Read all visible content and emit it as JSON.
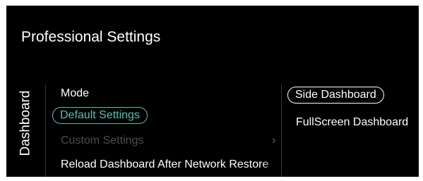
{
  "header": {
    "title": "Professional Settings"
  },
  "sidebar": {
    "tab_label": "Dashboard"
  },
  "menu": {
    "items": [
      {
        "label": "Mode",
        "state": "normal"
      },
      {
        "label": "Default Settings",
        "state": "selected"
      },
      {
        "label": "Custom Settings",
        "state": "disabled"
      },
      {
        "label": "Reload Dashboard After Network Restore",
        "state": "normal"
      }
    ],
    "submenu_chevron": "chevron-right-icon"
  },
  "options": {
    "items": [
      {
        "label": "Side Dashboard",
        "state": "highlighted"
      },
      {
        "label": "FullScreen Dashboard",
        "state": "normal"
      }
    ]
  },
  "colors": {
    "background": "#000000",
    "accent": "#58c2b4",
    "text": "#ffffff",
    "disabled_text": "#4d4d4d"
  }
}
